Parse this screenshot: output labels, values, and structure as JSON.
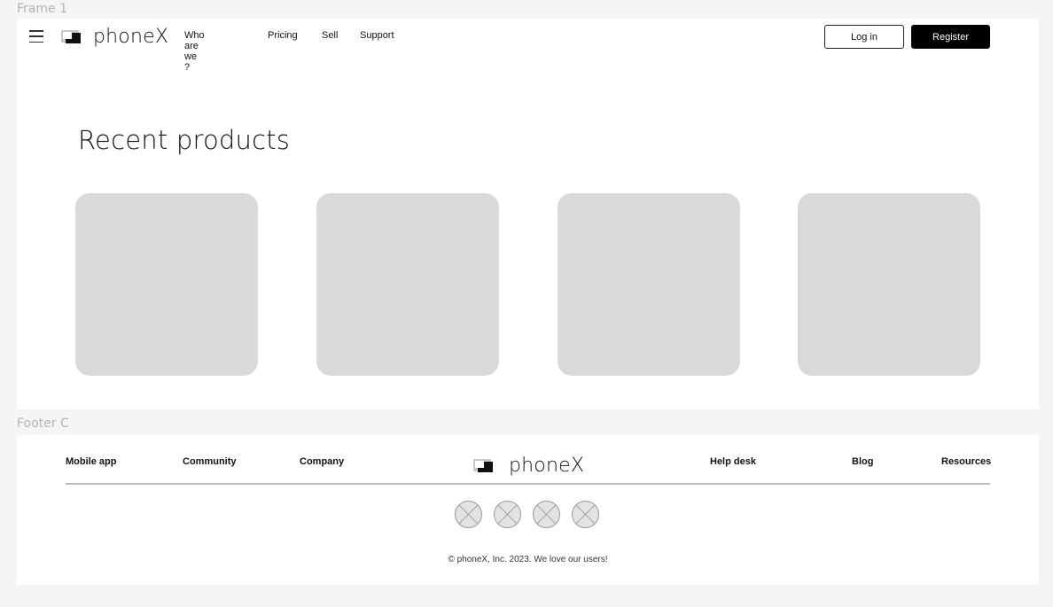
{
  "frame_labels": {
    "main": "Frame 1",
    "footer": "Footer C"
  },
  "header": {
    "menu_icon": "hamburger-menu-icon",
    "logo_text": "phoneX",
    "nav": {
      "who": "Who are we ?",
      "pricing": "Pricing",
      "sell": "Sell",
      "support": "Support"
    },
    "login_label": "Log in",
    "register_label": "Register"
  },
  "main": {
    "title": "Recent products",
    "products_count_visible": 4
  },
  "footer": {
    "left_links": [
      "Mobile app",
      "Community",
      "Company"
    ],
    "right_links": [
      "Help desk",
      "Blog",
      "Resources"
    ],
    "logo_text": "phoneX",
    "social_icons": [
      "placeholder-icon",
      "placeholder-icon",
      "placeholder-icon",
      "placeholder-icon"
    ],
    "copyright": "© phoneX, Inc. 2023. We love our users!"
  },
  "colors": {
    "card": "#d9d9d9",
    "register_bg": "#000000",
    "page_bg": "#f5f5f5"
  }
}
